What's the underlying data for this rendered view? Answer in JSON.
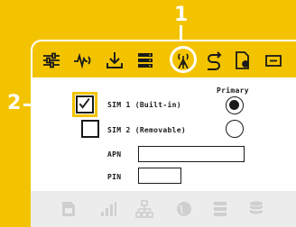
{
  "callouts": {
    "one": "1",
    "two": "2"
  },
  "toolbar": {
    "icons": [
      "sliders-icon",
      "pulse-icon",
      "download-icon",
      "server-icon",
      "cellular-antenna-icon",
      "route-icon",
      "document-gear-icon",
      "window-icon"
    ],
    "active": "cellular-antenna-icon"
  },
  "sim_panel": {
    "primary_header": "Primary",
    "sim1_label": "SIM 1 (Built-in)",
    "sim2_label": "SIM 2 (Removable)",
    "sim1_enabled": true,
    "sim2_enabled": false,
    "primary_selected": "SIM 1"
  },
  "fields": {
    "apn_label": "APN",
    "apn_value": "",
    "pin_label": "PIN",
    "pin_value": ""
  },
  "bottom_bar": {
    "icons": [
      "sim-card-icon",
      "signal-bars-icon",
      "network-tree-icon",
      "globe-icon",
      "server-icon",
      "database-icon"
    ]
  },
  "colors": {
    "accent": "#f3c300",
    "ink": "#1a1a1a",
    "muted": "#cfcfcf"
  }
}
